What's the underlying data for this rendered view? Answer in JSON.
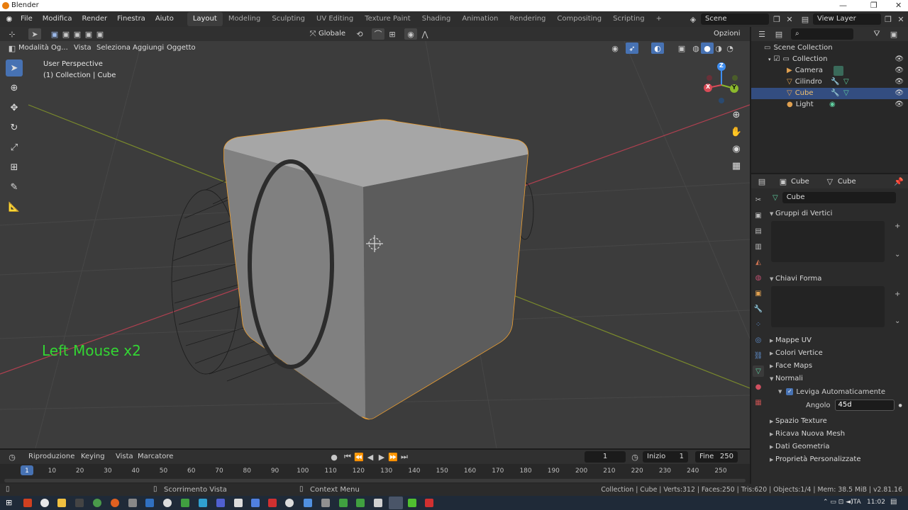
{
  "window": {
    "app_title": "Blender",
    "min_label": "—",
    "max_label": "❐",
    "close_label": "✕"
  },
  "menu": [
    "File",
    "Modifica",
    "Render",
    "Finestra",
    "Aiuto"
  ],
  "workspaces": [
    "Layout",
    "Modeling",
    "Sculpting",
    "UV Editing",
    "Texture Paint",
    "Shading",
    "Animation",
    "Rendering",
    "Compositing",
    "Scripting"
  ],
  "workspace_add": "+",
  "scene": {
    "label": "Scene",
    "view_layer": "View Layer"
  },
  "tool_header": {
    "orientation": "Globale",
    "options": "Opzioni"
  },
  "viewport_header": {
    "mode": "Modalità Og...",
    "menus": [
      "Vista",
      "Seleziona",
      "Aggiungi",
      "Oggetto"
    ]
  },
  "viewport": {
    "perspective": "User Perspective",
    "collection_info": "(1) Collection | Cube",
    "overlay_text": "Left Mouse x2",
    "overlay_color": "#33d633",
    "gizmo": {
      "z": "Z",
      "y": "Y",
      "x": "X"
    }
  },
  "outliner": {
    "root": "Scene Collection",
    "collection": "Collection",
    "items": [
      "Camera",
      "Cilindro",
      "Cube",
      "Light"
    ],
    "selected": "Cube"
  },
  "properties": {
    "object_name": "Cube",
    "data_name": "Cube",
    "mesh_field": "Cube",
    "sections": {
      "vertex_groups": "Gruppi di Vertici",
      "shape_keys": "Chiavi Forma",
      "uv_maps": "Mappe UV",
      "vertex_colors": "Colori Vertice",
      "face_maps": "Face Maps",
      "normals": "Normali",
      "texture_space": "Spazio Texture",
      "remesh": "Ricava Nuova Mesh",
      "geometry_data": "Dati Geometria",
      "custom_props": "Proprietà Personalizzate"
    },
    "auto_smooth": {
      "label": "Leviga Automaticamente",
      "checked": true
    },
    "angle": {
      "label": "Angolo",
      "value": "45d"
    }
  },
  "timeline": {
    "menus": [
      "Riproduzione",
      "Keying",
      "Vista",
      "Marcatore"
    ],
    "current_frame": "1",
    "start_label": "Inizio",
    "start": "1",
    "end_label": "Fine",
    "end": "250",
    "ruler": [
      "1",
      "10",
      "20",
      "30",
      "40",
      "50",
      "60",
      "70",
      "80",
      "90",
      "100",
      "110",
      "120",
      "130",
      "140",
      "150",
      "160",
      "170",
      "180",
      "190",
      "200",
      "210",
      "220",
      "230",
      "240",
      "250"
    ]
  },
  "status": {
    "middle": "Scorrimento Vista",
    "context": "Context Menu",
    "right": "Collection | Cube | Verts:312 | Faces:250 | Tris:620 | Objects:1/4 | Mem: 38.5 MiB | v2.81.16"
  },
  "taskbar": {
    "lang": "ITA",
    "time": "11:02"
  },
  "colors": {
    "accent": "#4772b3",
    "selection_outline": "#f0a030",
    "x_axis": "#d94b57",
    "y_axis": "#8bb82c",
    "z_axis": "#3f8ef0"
  }
}
